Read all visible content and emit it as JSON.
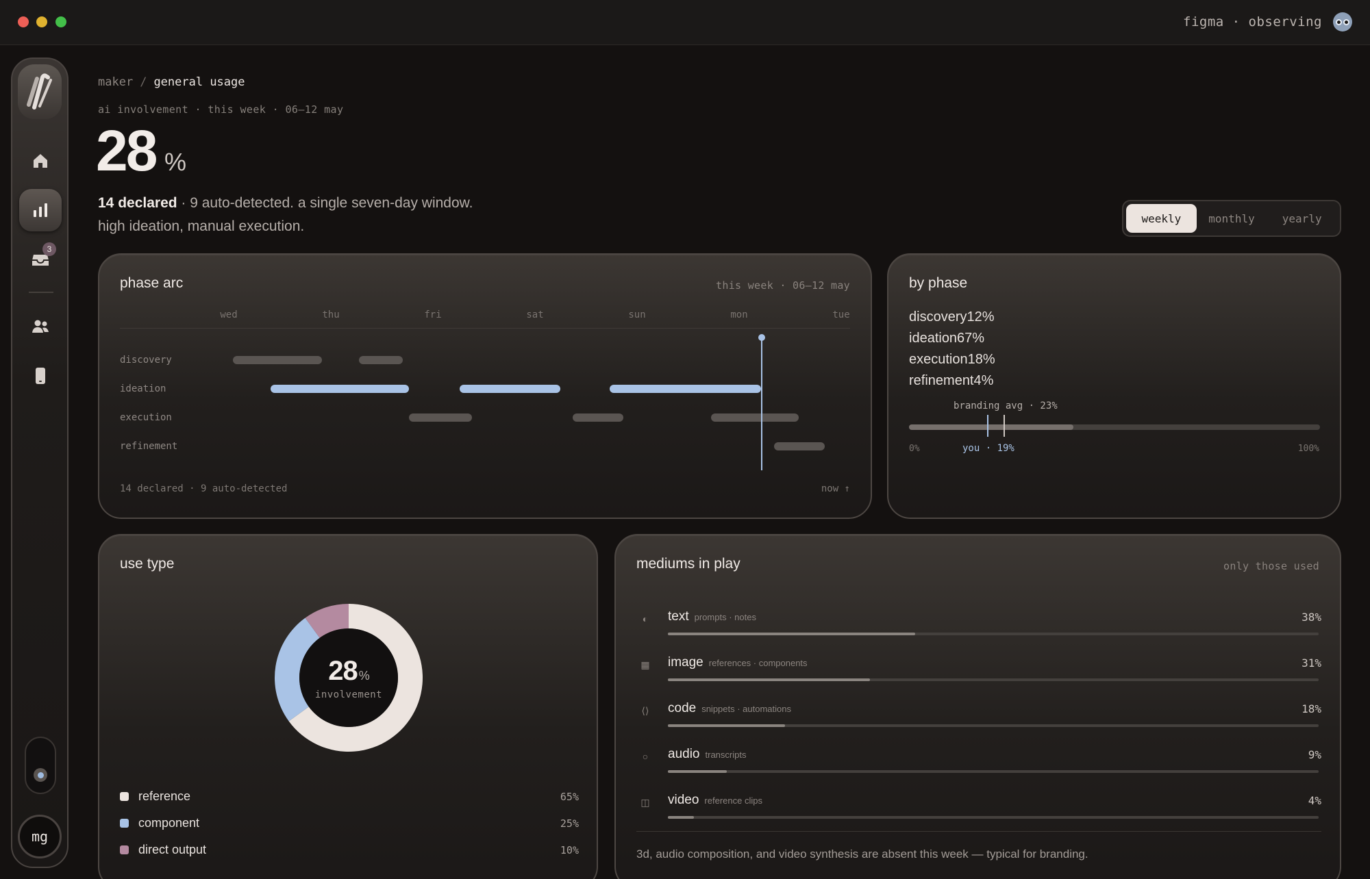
{
  "titlebar": {
    "app_status": "figma · observing"
  },
  "sidebar": {
    "inbox_badge": "3",
    "avatar": "mg"
  },
  "header": {
    "crumb_root": "maker",
    "crumb_sep": "/",
    "crumb_current": "general usage",
    "subhead": "ai involvement · this week · 06–12 may",
    "big_value": "28",
    "big_unit": "%",
    "declared": "14 declared",
    "summary_rest": " · 9 auto-detected. a single seven-day window.",
    "summary_line2": "high ideation, manual execution."
  },
  "range": {
    "options": [
      "weekly",
      "monthly",
      "yearly"
    ],
    "selected": "weekly"
  },
  "phase_arc": {
    "title": "phase arc",
    "meta": "this week · 06–12 may",
    "days": [
      "wed",
      "thu",
      "fri",
      "sat",
      "sun",
      "mon",
      "tue"
    ],
    "rows": [
      "discovery",
      "ideation",
      "execution",
      "refinement"
    ],
    "footer": "14 declared · 9 auto-detected",
    "now_label": "now ↑"
  },
  "by_phase": {
    "title": "by phase",
    "items": [
      "discovery12%",
      "ideation67%",
      "execution18%",
      "refinement4%"
    ],
    "avg_label": "branding avg · 23%",
    "you_label": "you · 19%",
    "min_label": "0%",
    "max_label": "100%",
    "you_value": 19,
    "avg_value": 23,
    "fill_value": 40
  },
  "use_type": {
    "title": "use type",
    "center_value": "28",
    "center_unit": "%",
    "center_label": "involvement",
    "legend": [
      {
        "name": "reference",
        "value": "65%",
        "color": "#ece4df",
        "pct": 65
      },
      {
        "name": "component",
        "value": "25%",
        "color": "#a9c3e6",
        "pct": 25
      },
      {
        "name": "direct output",
        "value": "10%",
        "color": "#b48aa0",
        "pct": 10
      }
    ]
  },
  "mediums": {
    "title": "mediums in play",
    "meta": "only those used",
    "items": [
      {
        "icon": "◐",
        "icon_name": "text-icon",
        "name": "text",
        "sub": "prompts · notes",
        "pct": "38%",
        "value": 38
      },
      {
        "icon": "▦",
        "icon_name": "image-icon",
        "name": "image",
        "sub": "references · components",
        "pct": "31%",
        "value": 31
      },
      {
        "icon": "⟨⟩",
        "icon_name": "code-icon",
        "name": "code",
        "sub": "snippets · automations",
        "pct": "18%",
        "value": 18
      },
      {
        "icon": "○",
        "icon_name": "audio-icon",
        "name": "audio",
        "sub": "transcripts",
        "pct": "9%",
        "value": 9
      },
      {
        "icon": "◫",
        "icon_name": "video-icon",
        "name": "video",
        "sub": "reference clips",
        "pct": "4%",
        "value": 4
      }
    ],
    "note": "3d, audio composition, and video synthesis are absent this week — typical for branding."
  }
}
